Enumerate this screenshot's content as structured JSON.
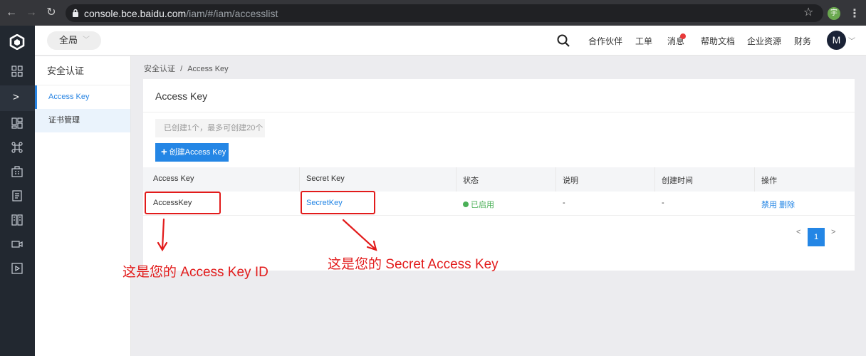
{
  "browser": {
    "url_host": "console.bce.baidu.com",
    "url_path": "/iam/#/iam/accesslist",
    "profile_initial": "宇"
  },
  "header": {
    "region_label": "全局",
    "nav": [
      "合作伙伴",
      "工单",
      "消息",
      "帮助文档",
      "企业资源",
      "财务"
    ],
    "avatar_initial": "M"
  },
  "sidebar": {
    "title": "安全认证",
    "items": [
      {
        "label": "Access Key",
        "active": true
      },
      {
        "label": "证书管理",
        "active": false
      }
    ]
  },
  "breadcrumb": {
    "parent": "安全认证",
    "separator": "/",
    "current": "Access Key"
  },
  "main": {
    "title": "Access Key",
    "hint": "已创建1个，最多可创建20个",
    "create_button": "创建Access Key",
    "table": {
      "headers": [
        "Access Key",
        "Secret Key",
        "状态",
        "说明",
        "创建时间",
        "操作"
      ],
      "rows": [
        {
          "access_key": "AccessKey",
          "secret_key": "SecretKey",
          "status": "已启用",
          "note": "-",
          "created": "-",
          "action_disable": "禁用",
          "action_delete": "删除"
        }
      ]
    },
    "pagination": {
      "prev": "<",
      "current": "1",
      "next": ">"
    }
  },
  "annotations": {
    "access_key_label": "这是您的 Access Key ID",
    "secret_key_label": "这是您的 Secret Access Key",
    "color": "#e21b1b"
  },
  "colors": {
    "accent": "#2486e5",
    "status_enabled": "#4ab057",
    "rail": "#222830"
  }
}
